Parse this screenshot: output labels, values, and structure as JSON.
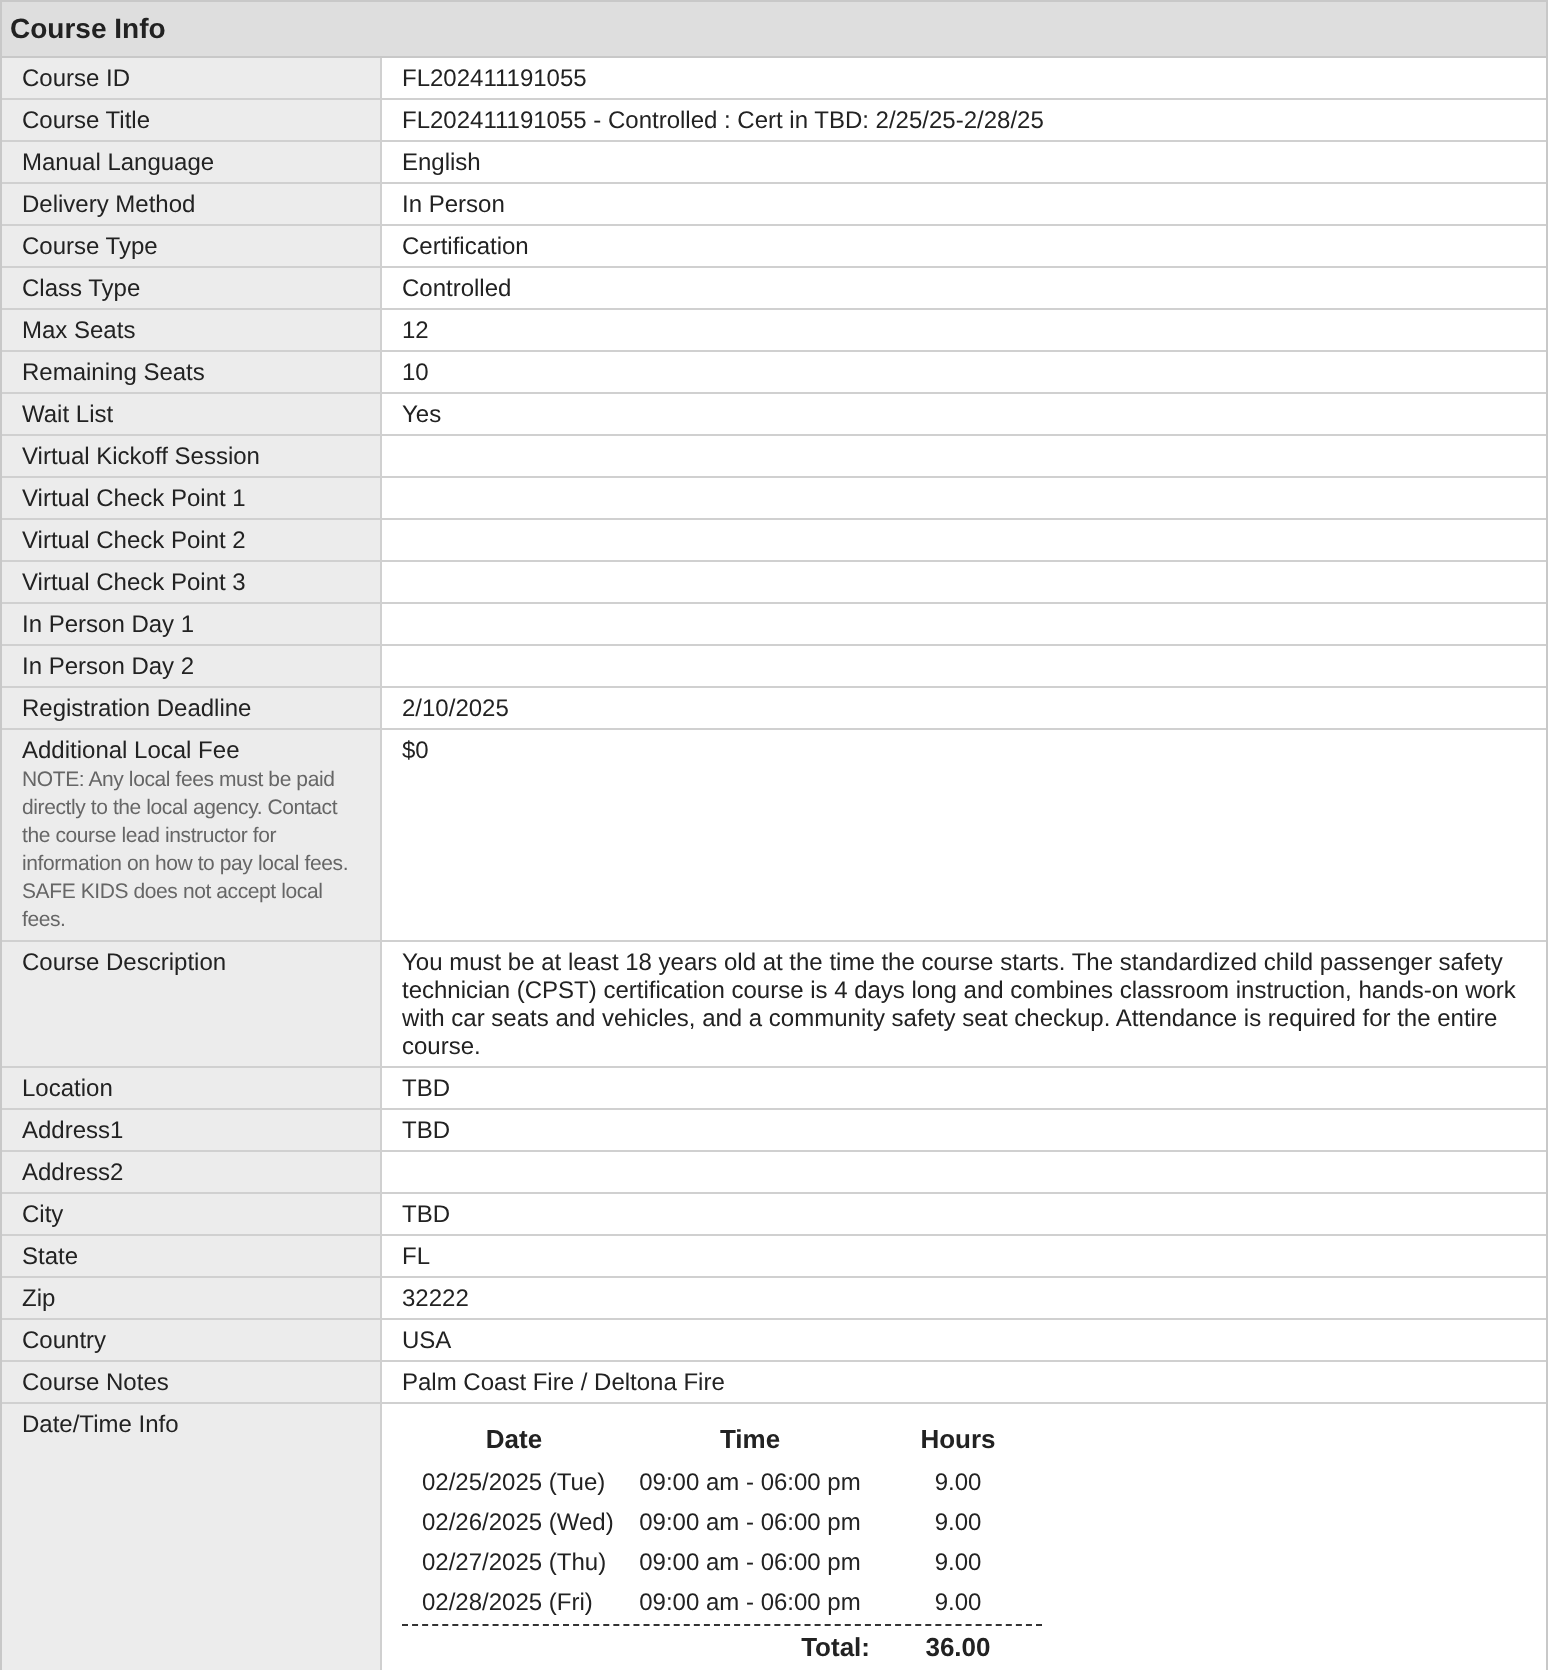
{
  "section_title": "Course Info",
  "rows": [
    {
      "label": "Course ID",
      "value": "FL202411191055"
    },
    {
      "label": "Course Title",
      "value": "FL202411191055 - Controlled : Cert in TBD: 2/25/25-2/28/25"
    },
    {
      "label": "Manual Language",
      "value": "English"
    },
    {
      "label": "Delivery Method",
      "value": "In Person"
    },
    {
      "label": "Course Type",
      "value": "Certification"
    },
    {
      "label": "Class Type",
      "value": "Controlled"
    },
    {
      "label": "Max Seats",
      "value": "12"
    },
    {
      "label": "Remaining Seats",
      "value": "10"
    },
    {
      "label": "Wait List",
      "value": "Yes"
    },
    {
      "label": "Virtual Kickoff Session"
    },
    {
      "label": "Virtual Check Point 1"
    },
    {
      "label": "Virtual Check Point 2"
    },
    {
      "label": "Virtual Check Point 3"
    },
    {
      "label": "In Person Day 1"
    },
    {
      "label": "In Person Day 2"
    },
    {
      "label": "Registration Deadline",
      "value": "2/10/2025"
    },
    {
      "label": "Additional Local Fee",
      "note": "NOTE: Any local fees must be paid directly to the local agency. Contact the course lead instructor for information on how to pay local fees. SAFE KIDS does not accept local fees.",
      "value": "$0"
    },
    {
      "label": "Course Description",
      "value": "You must be at least 18 years old at the time the course starts. The standardized child passenger safety technician (CPST) certification course is 4 days long and combines classroom instruction, hands-on work with car seats and vehicles, and a community safety seat checkup. Attendance is required for the entire course."
    },
    {
      "label": "Location",
      "value": "TBD"
    },
    {
      "label": "Address1",
      "value": "TBD"
    },
    {
      "label": "Address2"
    },
    {
      "label": "City",
      "value": "TBD"
    },
    {
      "label": "State",
      "value": "FL"
    },
    {
      "label": "Zip",
      "value": "32222"
    },
    {
      "label": "Country",
      "value": "USA"
    },
    {
      "label": "Course Notes",
      "value": "Palm Coast Fire / Deltona Fire"
    },
    {
      "label": "Date/Time Info",
      "schedule": {
        "columns": [
          "Date",
          "Time",
          "Hours"
        ],
        "sessions": [
          {
            "date": "02/25/2025 (Tue)",
            "time": "09:00 am - 06:00 pm",
            "hours": "9.00"
          },
          {
            "date": "02/26/2025 (Wed)",
            "time": "09:00 am - 06:00 pm",
            "hours": "9.00"
          },
          {
            "date": "02/27/2025 (Thu)",
            "time": "09:00 am - 06:00 pm",
            "hours": "9.00"
          },
          {
            "date": "02/28/2025 (Fri)",
            "time": "09:00 am - 06:00 pm",
            "hours": "9.00"
          }
        ],
        "total_label": "Total:",
        "total": "36.00"
      }
    }
  ]
}
